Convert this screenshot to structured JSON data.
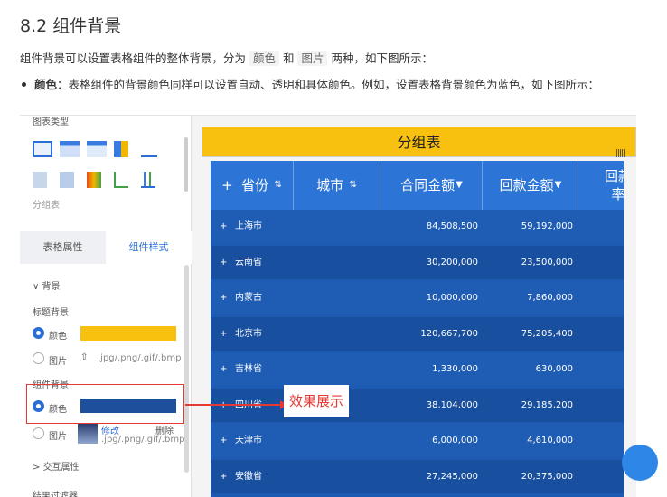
{
  "doc": {
    "section_title": "8.2 组件背景",
    "intro_prefix": "组件背景可以设置表格组件的整体背景，分为 ",
    "code_color": "颜色",
    "intro_and": " 和 ",
    "code_image": "图片",
    "intro_suffix": " 两种，如下图所示：",
    "bullet_bold": "颜色",
    "bullet_text": "：表格组件的背景颜色同样可以设置自动、透明和具体颜色。例如，设置表格背景颜色为蓝色，如下图所示："
  },
  "panel": {
    "chart_type_label": "图表类型",
    "group_table_label": "分组表",
    "tab_table_attr": "表格属性",
    "tab_component_style": "组件样式",
    "background_section": "背景",
    "title_bg_label": "标题背景",
    "color_label": "颜色",
    "image_label": "图片",
    "upload_hint": ".jpg/.png/.gif/.bmp",
    "component_bg_label": "组件背景",
    "color_label2": "颜色",
    "image_label2": "图片",
    "modify_label": "修改",
    "delete_label": "删除",
    "upload_hint2": ".jpg/.png/.gif/.bmp",
    "interaction_section": "交互属性",
    "result_filter": "结果过滤器",
    "title_swatch_color": "#f9c10f",
    "comp_swatch_color": "#1d4f9c"
  },
  "table": {
    "title": "分组表",
    "headers": [
      "省份",
      "城市",
      "合同金额",
      "回款金额",
      "回款率"
    ],
    "rows": [
      {
        "province": "上海市",
        "contract": "84,508,500",
        "payment": "59,192,000"
      },
      {
        "province": "云南省",
        "contract": "30,200,000",
        "payment": "23,500,000"
      },
      {
        "province": "内蒙古",
        "contract": "10,000,000",
        "payment": "7,860,000"
      },
      {
        "province": "北京市",
        "contract": "120,667,700",
        "payment": "75,205,400"
      },
      {
        "province": "吉林省",
        "contract": "1,330,000",
        "payment": "630,000"
      },
      {
        "province": "四川省",
        "contract": "38,104,000",
        "payment": "29,185,200"
      },
      {
        "province": "天津市",
        "contract": "6,000,000",
        "payment": "4,610,000"
      },
      {
        "province": "安徽省",
        "contract": "27,245,000",
        "payment": "20,375,000"
      }
    ]
  },
  "annotation": "效果展示"
}
